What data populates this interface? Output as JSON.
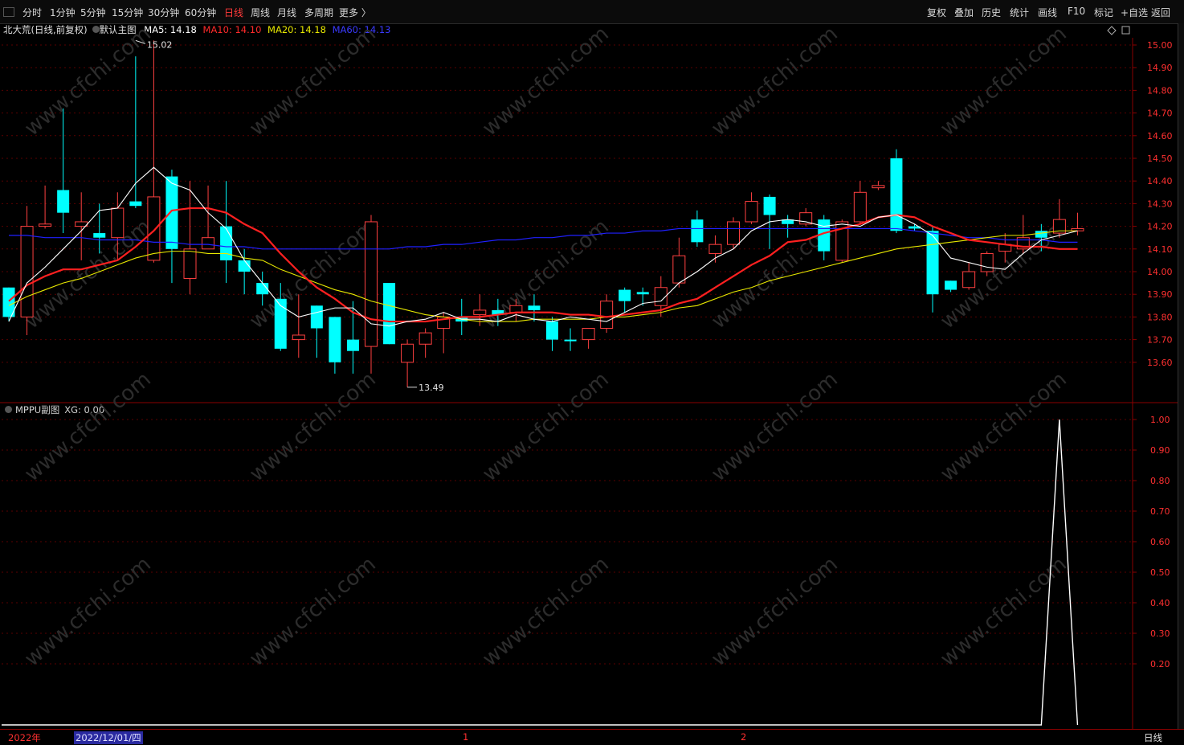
{
  "toolbar": {
    "periods": [
      "分时",
      "1分钟",
      "5分钟",
      "15分钟",
      "30分钟",
      "60分钟",
      "日线",
      "周线",
      "月线",
      "多周期",
      "更多 〉"
    ],
    "active_period": "日线",
    "right_tools": [
      "复权",
      "叠加",
      "历史",
      "统计",
      "画线",
      "F10",
      "标记",
      "+自选",
      "返回"
    ]
  },
  "main_chart": {
    "stock_name": "北大荒(日线,前复权)",
    "template": "默认主图",
    "ma5_label": "MA5: 14.18",
    "ma10_label": "MA10: 14.10",
    "ma20_label": "MA20: 14.18",
    "ma60_label": "MA60: 14.13",
    "high_marker": "15.02",
    "low_marker": "13.49",
    "price_ticks": [
      "15.00",
      "14.90",
      "14.80",
      "14.70",
      "14.60",
      "14.50",
      "14.40",
      "14.30",
      "14.20",
      "14.10",
      "14.00",
      "13.90",
      "13.80",
      "13.70",
      "13.60"
    ]
  },
  "sub_chart": {
    "title": "MPPU副图",
    "xg_label": "XG: 0.00",
    "ticks": [
      "1.00",
      "0.90",
      "0.80",
      "0.70",
      "0.60",
      "0.50",
      "0.40",
      "0.30",
      "0.20"
    ]
  },
  "bottom": {
    "year": "2022年",
    "cursor_date": "2022/12/01/四",
    "month1": "1",
    "month2": "2",
    "period": "日线"
  },
  "watermark": "www.cfchi.com",
  "colors": {
    "up": "#ff4040",
    "down": "#00ffff",
    "ma5": "#ffffff",
    "ma10": "#ff2020",
    "ma20": "#e8e800",
    "ma60": "#2020ff",
    "axis": "#ff3030"
  },
  "chart_data": {
    "type": "candlestick",
    "ylim": [
      13.5,
      15.05
    ],
    "candles": [
      {
        "o": 13.8,
        "h": 13.93,
        "l": 13.78,
        "c": 13.93,
        "dir": "down"
      },
      {
        "o": 13.8,
        "h": 14.29,
        "l": 13.72,
        "c": 14.2,
        "dir": "up"
      },
      {
        "o": 14.2,
        "h": 14.38,
        "l": 14.19,
        "c": 14.21,
        "dir": "up"
      },
      {
        "o": 14.36,
        "h": 14.72,
        "l": 14.17,
        "c": 14.26,
        "dir": "down"
      },
      {
        "o": 14.22,
        "h": 14.35,
        "l": 14.05,
        "c": 14.2,
        "dir": "up"
      },
      {
        "o": 14.17,
        "h": 14.3,
        "l": 14.08,
        "c": 14.15,
        "dir": "down"
      },
      {
        "o": 14.15,
        "h": 14.35,
        "l": 14.05,
        "c": 14.28,
        "dir": "up"
      },
      {
        "o": 14.31,
        "h": 14.95,
        "l": 14.28,
        "c": 14.29,
        "dir": "down"
      },
      {
        "o": 14.05,
        "h": 15.02,
        "l": 14.04,
        "c": 14.33,
        "dir": "up"
      },
      {
        "o": 14.42,
        "h": 14.45,
        "l": 13.95,
        "c": 14.1,
        "dir": "down"
      },
      {
        "o": 13.97,
        "h": 14.4,
        "l": 13.9,
        "c": 14.1,
        "dir": "up"
      },
      {
        "o": 14.1,
        "h": 14.38,
        "l": 14.1,
        "c": 14.15,
        "dir": "up"
      },
      {
        "o": 14.2,
        "h": 14.4,
        "l": 13.95,
        "c": 14.05,
        "dir": "down"
      },
      {
        "o": 14.05,
        "h": 14.1,
        "l": 13.9,
        "c": 14.0,
        "dir": "down"
      },
      {
        "o": 13.95,
        "h": 14.0,
        "l": 13.85,
        "c": 13.9,
        "dir": "down"
      },
      {
        "o": 13.88,
        "h": 13.95,
        "l": 13.65,
        "c": 13.66,
        "dir": "down"
      },
      {
        "o": 13.7,
        "h": 13.9,
        "l": 13.62,
        "c": 13.72,
        "dir": "up"
      },
      {
        "o": 13.85,
        "h": 13.85,
        "l": 13.62,
        "c": 13.75,
        "dir": "down"
      },
      {
        "o": 13.8,
        "h": 13.8,
        "l": 13.55,
        "c": 13.6,
        "dir": "down"
      },
      {
        "o": 13.7,
        "h": 13.87,
        "l": 13.55,
        "c": 13.65,
        "dir": "down"
      },
      {
        "o": 13.67,
        "h": 14.25,
        "l": 13.55,
        "c": 14.22,
        "dir": "up"
      },
      {
        "o": 13.95,
        "h": 13.95,
        "l": 13.68,
        "c": 13.68,
        "dir": "down"
      },
      {
        "o": 13.6,
        "h": 13.7,
        "l": 13.49,
        "c": 13.68,
        "dir": "up"
      },
      {
        "o": 13.68,
        "h": 13.75,
        "l": 13.62,
        "c": 13.73,
        "dir": "up"
      },
      {
        "o": 13.75,
        "h": 13.82,
        "l": 13.64,
        "c": 13.8,
        "dir": "up"
      },
      {
        "o": 13.78,
        "h": 13.88,
        "l": 13.72,
        "c": 13.8,
        "dir": "down"
      },
      {
        "o": 13.81,
        "h": 13.9,
        "l": 13.76,
        "c": 13.83,
        "dir": "up"
      },
      {
        "o": 13.83,
        "h": 13.88,
        "l": 13.76,
        "c": 13.81,
        "dir": "down"
      },
      {
        "o": 13.82,
        "h": 13.88,
        "l": 13.78,
        "c": 13.85,
        "dir": "up"
      },
      {
        "o": 13.85,
        "h": 13.9,
        "l": 13.78,
        "c": 13.83,
        "dir": "down"
      },
      {
        "o": 13.78,
        "h": 13.8,
        "l": 13.65,
        "c": 13.7,
        "dir": "down"
      },
      {
        "o": 13.7,
        "h": 13.75,
        "l": 13.65,
        "c": 13.7,
        "dir": "down"
      },
      {
        "o": 13.7,
        "h": 13.75,
        "l": 13.66,
        "c": 13.75,
        "dir": "up"
      },
      {
        "o": 13.75,
        "h": 13.9,
        "l": 13.73,
        "c": 13.87,
        "dir": "up"
      },
      {
        "o": 13.92,
        "h": 13.93,
        "l": 13.82,
        "c": 13.87,
        "dir": "down"
      },
      {
        "o": 13.91,
        "h": 13.93,
        "l": 13.85,
        "c": 13.9,
        "dir": "down"
      },
      {
        "o": 13.85,
        "h": 13.98,
        "l": 13.8,
        "c": 13.93,
        "dir": "up"
      },
      {
        "o": 13.95,
        "h": 14.15,
        "l": 13.93,
        "c": 14.07,
        "dir": "up"
      },
      {
        "o": 14.23,
        "h": 14.27,
        "l": 14.11,
        "c": 14.13,
        "dir": "down"
      },
      {
        "o": 14.08,
        "h": 14.16,
        "l": 14.04,
        "c": 14.12,
        "dir": "up"
      },
      {
        "o": 14.12,
        "h": 14.24,
        "l": 14.1,
        "c": 14.22,
        "dir": "up"
      },
      {
        "o": 14.22,
        "h": 14.35,
        "l": 14.21,
        "c": 14.31,
        "dir": "up"
      },
      {
        "o": 14.33,
        "h": 14.34,
        "l": 14.1,
        "c": 14.25,
        "dir": "down"
      },
      {
        "o": 14.23,
        "h": 14.25,
        "l": 14.15,
        "c": 14.21,
        "dir": "down"
      },
      {
        "o": 14.21,
        "h": 14.28,
        "l": 14.2,
        "c": 14.26,
        "dir": "up"
      },
      {
        "o": 14.23,
        "h": 14.25,
        "l": 14.05,
        "c": 14.09,
        "dir": "down"
      },
      {
        "o": 14.05,
        "h": 14.23,
        "l": 14.04,
        "c": 14.22,
        "dir": "up"
      },
      {
        "o": 14.22,
        "h": 14.4,
        "l": 14.21,
        "c": 14.35,
        "dir": "up"
      },
      {
        "o": 14.38,
        "h": 14.4,
        "l": 14.36,
        "c": 14.37,
        "dir": "up"
      },
      {
        "o": 14.5,
        "h": 14.54,
        "l": 14.17,
        "c": 14.18,
        "dir": "down"
      },
      {
        "o": 14.2,
        "h": 14.21,
        "l": 14.18,
        "c": 14.19,
        "dir": "down"
      },
      {
        "o": 14.18,
        "h": 14.2,
        "l": 13.82,
        "c": 13.9,
        "dir": "down"
      },
      {
        "o": 13.96,
        "h": 13.96,
        "l": 13.91,
        "c": 13.92,
        "dir": "down"
      },
      {
        "o": 13.93,
        "h": 14.04,
        "l": 13.92,
        "c": 14.0,
        "dir": "up"
      },
      {
        "o": 14.0,
        "h": 14.09,
        "l": 13.98,
        "c": 14.08,
        "dir": "up"
      },
      {
        "o": 14.09,
        "h": 14.17,
        "l": 14.04,
        "c": 14.12,
        "dir": "up"
      },
      {
        "o": 14.1,
        "h": 14.25,
        "l": 14.08,
        "c": 14.15,
        "dir": "up"
      },
      {
        "o": 14.18,
        "h": 14.21,
        "l": 14.09,
        "c": 14.15,
        "dir": "down"
      },
      {
        "o": 14.17,
        "h": 14.32,
        "l": 14.15,
        "c": 14.23,
        "dir": "up"
      },
      {
        "o": 14.19,
        "h": 14.26,
        "l": 14.16,
        "c": 14.18,
        "dir": "up"
      }
    ],
    "ma5": [
      13.78,
      13.95,
      14.02,
      14.1,
      14.18,
      14.27,
      14.28,
      14.39,
      14.46,
      14.39,
      14.36,
      14.26,
      14.19,
      14.05,
      13.95,
      13.85,
      13.8,
      13.82,
      13.84,
      13.84,
      13.77,
      13.76,
      13.78,
      13.79,
      13.82,
      13.79,
      13.79,
      13.78,
      13.81,
      13.79,
      13.78,
      13.8,
      13.79,
      13.78,
      13.82,
      13.86,
      13.87,
      13.95,
      14.0,
      14.06,
      14.1,
      14.18,
      14.22,
      14.23,
      14.22,
      14.2,
      14.21,
      14.2,
      14.24,
      14.25,
      14.21,
      14.16,
      14.06,
      14.04,
      14.02,
      14.01,
      14.08,
      14.14,
      14.16,
      14.18
    ],
    "ma10": [
      13.87,
      13.94,
      13.98,
      14.01,
      14.01,
      14.03,
      14.05,
      14.11,
      14.18,
      14.27,
      14.28,
      14.28,
      14.26,
      14.21,
      14.17,
      14.08,
      14.0,
      13.93,
      13.88,
      13.82,
      13.79,
      13.78,
      13.78,
      13.78,
      13.79,
      13.8,
      13.8,
      13.81,
      13.82,
      13.82,
      13.82,
      13.81,
      13.81,
      13.8,
      13.81,
      13.82,
      13.83,
      13.86,
      13.88,
      13.93,
      13.98,
      14.03,
      14.07,
      14.13,
      14.14,
      14.17,
      14.19,
      14.21,
      14.24,
      14.25,
      14.24,
      14.2,
      14.17,
      14.14,
      14.13,
      14.12,
      14.11,
      14.11,
      14.1,
      14.1
    ],
    "ma20": [
      13.85,
      13.89,
      13.92,
      13.95,
      13.97,
      14.0,
      14.03,
      14.06,
      14.08,
      14.09,
      14.09,
      14.08,
      14.08,
      14.06,
      14.05,
      14.01,
      13.98,
      13.95,
      13.92,
      13.9,
      13.87,
      13.85,
      13.83,
      13.81,
      13.8,
      13.79,
      13.78,
      13.78,
      13.78,
      13.79,
      13.79,
      13.79,
      13.79,
      13.8,
      13.8,
      13.81,
      13.82,
      13.84,
      13.85,
      13.88,
      13.91,
      13.93,
      13.96,
      13.98,
      14.0,
      14.02,
      14.04,
      14.06,
      14.08,
      14.1,
      14.11,
      14.12,
      14.13,
      14.14,
      14.15,
      14.16,
      14.16,
      14.17,
      14.18,
      14.18
    ],
    "ma60": [
      14.16,
      14.16,
      14.15,
      14.15,
      14.15,
      14.14,
      14.14,
      14.14,
      14.13,
      14.13,
      14.12,
      14.12,
      14.11,
      14.11,
      14.1,
      14.1,
      14.1,
      14.1,
      14.1,
      14.1,
      14.1,
      14.1,
      14.11,
      14.11,
      14.12,
      14.12,
      14.13,
      14.14,
      14.14,
      14.15,
      14.15,
      14.16,
      14.16,
      14.17,
      14.17,
      14.18,
      14.18,
      14.19,
      14.19,
      14.19,
      14.19,
      14.19,
      14.19,
      14.19,
      14.19,
      14.19,
      14.19,
      14.19,
      14.19,
      14.19,
      14.18,
      14.17,
      14.16,
      14.15,
      14.15,
      14.14,
      14.14,
      14.14,
      14.13,
      14.13
    ],
    "xg": [
      0,
      0,
      0,
      0,
      0,
      0,
      0,
      0,
      0,
      0,
      0,
      0,
      0,
      0,
      0,
      0,
      0,
      0,
      0,
      0,
      0,
      0,
      0,
      0,
      0,
      0,
      0,
      0,
      0,
      0,
      0,
      0,
      0,
      0,
      0,
      0,
      0,
      0,
      0,
      0,
      0,
      0,
      0,
      0,
      0,
      0,
      0,
      0,
      0,
      0,
      0,
      0,
      0,
      0,
      0,
      0,
      0,
      0,
      1,
      0
    ]
  }
}
